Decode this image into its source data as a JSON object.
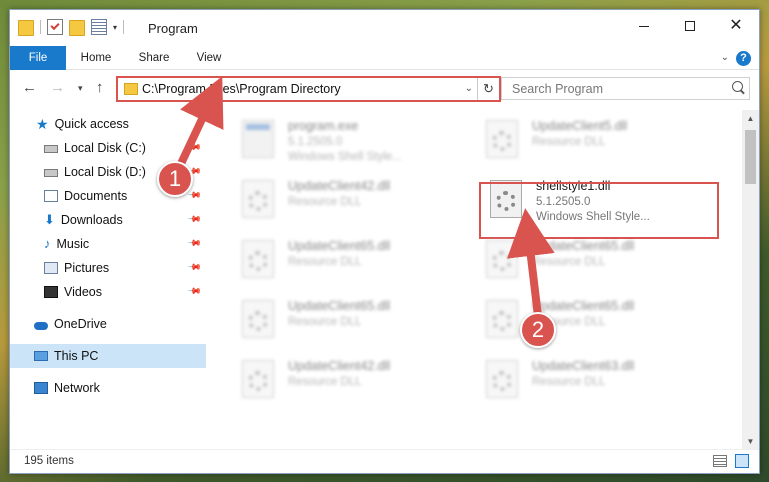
{
  "window": {
    "title": "Program",
    "controls": {
      "minimize": "—",
      "maximize": "☐",
      "close": "✕"
    }
  },
  "ribbon": {
    "tabs": [
      {
        "label": "File"
      },
      {
        "label": "Home"
      },
      {
        "label": "Share"
      },
      {
        "label": "View"
      }
    ],
    "help": "?"
  },
  "address_bar": {
    "path": "C:\\Program Files\\Program Directory",
    "refresh_icon": "↻"
  },
  "search": {
    "placeholder": "Search Program"
  },
  "nav_pane": {
    "items": [
      {
        "label": "Quick access",
        "icon": "star-icon"
      },
      {
        "label": "Local Disk (C:)",
        "icon": "drive-icon"
      },
      {
        "label": "Local Disk (D:)",
        "icon": "drive-icon"
      },
      {
        "label": "Documents",
        "icon": "documents-icon"
      },
      {
        "label": "Downloads",
        "icon": "download-icon"
      },
      {
        "label": "Music",
        "icon": "music-icon"
      },
      {
        "label": "Pictures",
        "icon": "pictures-icon"
      },
      {
        "label": "Videos",
        "icon": "videos-icon"
      },
      {
        "label": "OneDrive",
        "icon": "cloud-icon"
      },
      {
        "label": "This PC",
        "icon": "computer-icon"
      },
      {
        "label": "Network",
        "icon": "network-icon"
      }
    ]
  },
  "files": [
    {
      "name": "program.exe",
      "line2": "5.1.2505.0",
      "line3": "Windows Shell Style..."
    },
    {
      "name": "UpdateClient5.dll",
      "line2": "Resource DLL",
      "line3": ""
    },
    {
      "name": "UpdateClient42.dll",
      "line2": "Resource DLL",
      "line3": ""
    },
    {
      "name": "shellstyle1.dll",
      "line2": "5.1.2505.0",
      "line3": "Windows Shell Style..."
    },
    {
      "name": "UpdateClient65.dll",
      "line2": "Resource DLL",
      "line3": ""
    },
    {
      "name": "UpdateClient65.dll",
      "line2": "Resource DLL",
      "line3": ""
    },
    {
      "name": "UpdateClient65.dll",
      "line2": "Resource DLL",
      "line3": ""
    },
    {
      "name": "UpdateClient65.dll",
      "line2": "Resource DLL",
      "line3": ""
    },
    {
      "name": "UpdateClient42.dll",
      "line2": "Resource DLL",
      "line3": ""
    },
    {
      "name": "UpdateClient63.dll",
      "line2": "Resource DLL",
      "line3": ""
    }
  ],
  "status_bar": {
    "item_count": "195 items"
  },
  "annotations": {
    "step1": "1",
    "step2": "2",
    "color": "#d9534f"
  }
}
